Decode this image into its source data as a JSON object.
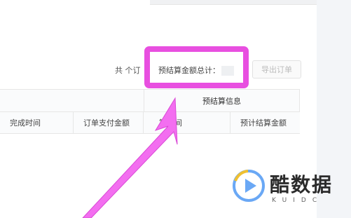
{
  "toolbar": {
    "order_count_label": "共 个订",
    "settlement_total_label": "预结算金额总计：",
    "export_label": "导出订单"
  },
  "table": {
    "group_header": "预结算信息",
    "columns": [
      "完成时间",
      "订单支付金额",
      "算时间",
      "预计结算金额"
    ]
  },
  "annotation": {
    "highlight_color": "#e84fe0",
    "arrow_color": "#f36ef0"
  },
  "watermark": {
    "title": "酷数据",
    "subtitle": "KUIDC",
    "logo_icon": "play-icon",
    "logo_colors": [
      "#6aa8f5",
      "#f0c030"
    ]
  }
}
